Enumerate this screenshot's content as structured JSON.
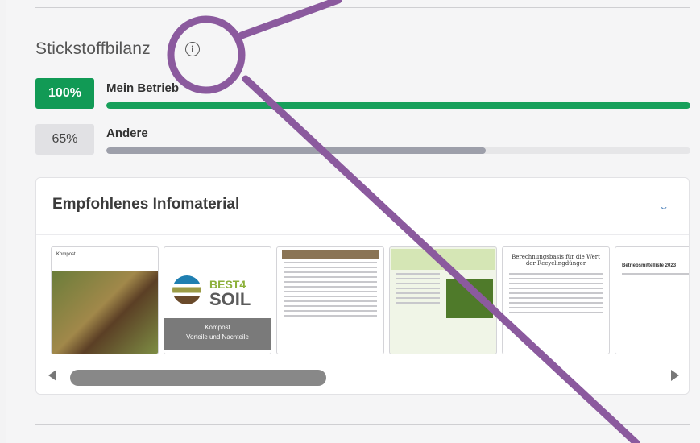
{
  "section": {
    "title": "Stickstoffbilanz",
    "info_icon": "info-icon"
  },
  "bars": [
    {
      "percent_label": "100%",
      "label": "Mein Betrieb",
      "fraction": 1.0,
      "color": "#17a05b"
    },
    {
      "percent_label": "65%",
      "label": "Andere",
      "fraction": 0.65,
      "color": "#9d9faa"
    }
  ],
  "infomaterial": {
    "title": "Empfohlenes Infomaterial",
    "toggle_icon": "chevron-down-icon",
    "thumbnails": [
      {
        "title": "Kompost",
        "icon": "soil-photo-thumbnail"
      },
      {
        "brand": "BEST4",
        "brand2": "SOIL",
        "line1": "Kompost",
        "line2": "Vorteile und Nachteile"
      },
      {
        "title": "",
        "icon": "text-document-thumbnail"
      },
      {
        "title": "",
        "icon": "green-leaflet-thumbnail"
      },
      {
        "title": "Berechnungsbasis für die Wert der Recyclingdünger",
        "icon": "formula-document-thumbnail"
      },
      {
        "title": "Betriebsmittelliste 2023",
        "icon": "list-document-thumbnail"
      }
    ]
  },
  "annotation_color": "#8b5a9e"
}
